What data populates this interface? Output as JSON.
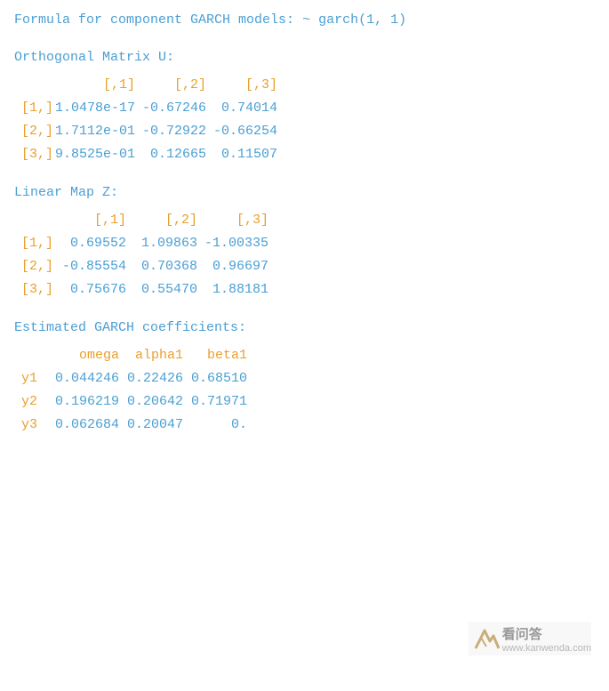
{
  "formula": {
    "label": "Formula for component GARCH models:",
    "value": "~ garch(1, 1)"
  },
  "orthogonal_matrix": {
    "header": "Orthogonal Matrix U:",
    "col_headers": [
      "[,1]",
      "[,2]",
      "[,3]"
    ],
    "rows": [
      {
        "label": "[1,]",
        "values": [
          "1.0478e-17",
          "-0.67246",
          "0.74014"
        ]
      },
      {
        "label": "[2,]",
        "values": [
          "1.7112e-01",
          "-0.72922",
          "-0.66254"
        ]
      },
      {
        "label": "[3,]",
        "values": [
          "9.8525e-01",
          "0.12665",
          "0.11507"
        ]
      }
    ]
  },
  "linear_map": {
    "header": "Linear Map Z:",
    "col_headers": [
      "[,1]",
      "[,2]",
      "[,3]"
    ],
    "rows": [
      {
        "label": "[1,]",
        "values": [
          "0.69552",
          "1.09863",
          "-1.00335"
        ]
      },
      {
        "label": "[2,]",
        "values": [
          "-0.85554",
          "0.70368",
          "0.96697"
        ]
      },
      {
        "label": "[3,]",
        "values": [
          "0.75676",
          "0.55470",
          "1.88181"
        ]
      }
    ]
  },
  "garch_coefs": {
    "header": "Estimated GARCH coefficients:",
    "col_headers": [
      "omega",
      "alpha1",
      "beta1"
    ],
    "rows": [
      {
        "label": "y1",
        "values": [
          "0.044246",
          "0.22426",
          "0.68510"
        ]
      },
      {
        "label": "y2",
        "values": [
          "0.196219",
          "0.20642",
          "0.71971"
        ]
      },
      {
        "label": "y3",
        "values": [
          "0.062684",
          "0.20047",
          "0."
        ]
      }
    ]
  },
  "watermark": {
    "icon": "K",
    "text": "看问答",
    "url_text": "www.kanwenda.com"
  }
}
